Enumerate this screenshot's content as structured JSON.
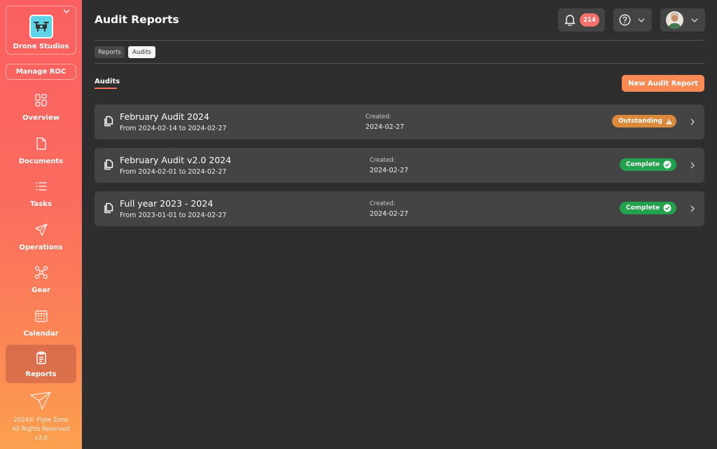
{
  "org": {
    "name": "Drone Studios",
    "logo_icon": "drone-icon"
  },
  "sidebar": {
    "manage_label": "Manage ROC",
    "items": [
      {
        "label": "Overview",
        "icon": "grid-icon"
      },
      {
        "label": "Documents",
        "icon": "document-icon"
      },
      {
        "label": "Tasks",
        "icon": "list-icon"
      },
      {
        "label": "Operations",
        "icon": "paper-plane-icon"
      },
      {
        "label": "Gear",
        "icon": "drone-frame-icon"
      },
      {
        "label": "Calendar",
        "icon": "calendar-icon"
      },
      {
        "label": "Reports",
        "icon": "clipboard-icon",
        "active": true
      }
    ],
    "footer": {
      "line1": "2024© Flyte Zone",
      "line2": "All Rights Reserved",
      "line3": "v3.0"
    }
  },
  "header": {
    "title": "Audit Reports",
    "notification_count": "214"
  },
  "tabs": [
    {
      "label": "Reports"
    },
    {
      "label": "Audits",
      "active": true
    }
  ],
  "section": {
    "title": "Audits",
    "new_button": "New Audit Report"
  },
  "audits": [
    {
      "title": "February Audit 2024",
      "range": "From 2024-02-14 to 2024-02-27",
      "created_label": "Created:",
      "created_date": "2024-02-27",
      "status": "Outstanding"
    },
    {
      "title": "February Audit v2.0 2024",
      "range": "From 2024-02-01 to 2024-02-27",
      "created_label": "Created:",
      "created_date": "2024-02-27",
      "status": "Complete"
    },
    {
      "title": "Full year 2023 - 2024",
      "range": "From 2023-01-01 to 2024-02-27",
      "created_label": "Created:",
      "created_date": "2024-02-27",
      "status": "Complete"
    }
  ],
  "colors": {
    "accent": "#fb8a54",
    "outstanding": "#db8a3c",
    "complete": "#22a24c",
    "badge": "#f96f6a"
  }
}
